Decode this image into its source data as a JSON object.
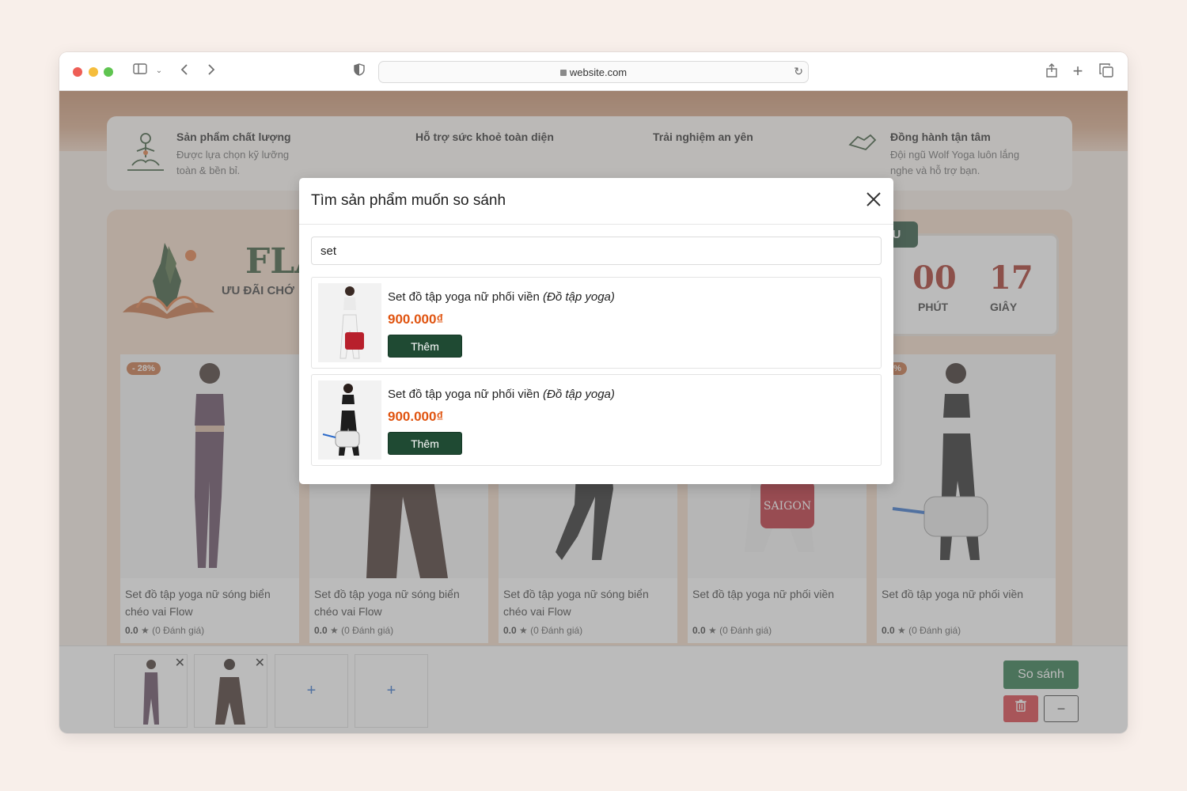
{
  "browser": {
    "url": "website.com"
  },
  "features": [
    {
      "title": "Sản phẩm chất lượng",
      "desc1": "Được lựa chọn kỹ lưỡng",
      "desc2": "toàn & bền bỉ."
    },
    {
      "title": "Hỗ trợ sức khoẻ toàn diện"
    },
    {
      "title": "Trải nghiệm an yên"
    },
    {
      "title": "Đồng hành tận tâm",
      "desc1": "Đội ngũ Wolf Yoga luôn lắng",
      "desc2": "nghe và hỗ trợ bạn."
    }
  ],
  "flash_sale": {
    "title": "FLA",
    "subtitle": "ƯU ĐÃI CHỚ",
    "countdown_label": "HÚC SAU",
    "minutes": "00",
    "minutes_label": "PHÚT",
    "seconds": "17",
    "seconds_label": "GIÂY"
  },
  "products": [
    {
      "badge": "- 28%",
      "name": "Set đồ tập yoga nữ sóng biển chéo vai Flow",
      "rating": "0.0",
      "reviews": "(0 Đánh giá)"
    },
    {
      "badge": "",
      "name": "Set đồ tập yoga nữ sóng biển chéo vai Flow",
      "rating": "0.0",
      "reviews": "(0 Đánh giá)"
    },
    {
      "badge": "",
      "name": "Set đồ tập yoga nữ sóng biển chéo vai Flow",
      "rating": "0.0",
      "reviews": "(0 Đánh giá)"
    },
    {
      "badge": "",
      "name": "Set đồ tập yoga nữ phối viền",
      "rating": "0.0",
      "reviews": "(0 Đánh giá)"
    },
    {
      "badge": "5%",
      "name": "Set đồ tập yoga nữ phối viền",
      "rating": "0.0",
      "reviews": "(0 Đánh giá)"
    }
  ],
  "compare_bar": {
    "compare_label": "So sánh"
  },
  "modal": {
    "title": "Tìm sản phẩm muốn so sánh",
    "search_value": "set",
    "results": [
      {
        "name": "Set đồ tập yoga nữ phối viền",
        "category": "(Đồ tập yoga)",
        "price": "900.000₫",
        "button": "Thêm"
      },
      {
        "name": "Set đồ tập yoga nữ phối viền",
        "category": "(Đồ tập yoga)",
        "price": "900.000₫",
        "button": "Thêm"
      }
    ]
  },
  "colors": {
    "accent_green": "#1f4a33",
    "price_orange": "#e05410",
    "danger_red": "#d9323a"
  }
}
